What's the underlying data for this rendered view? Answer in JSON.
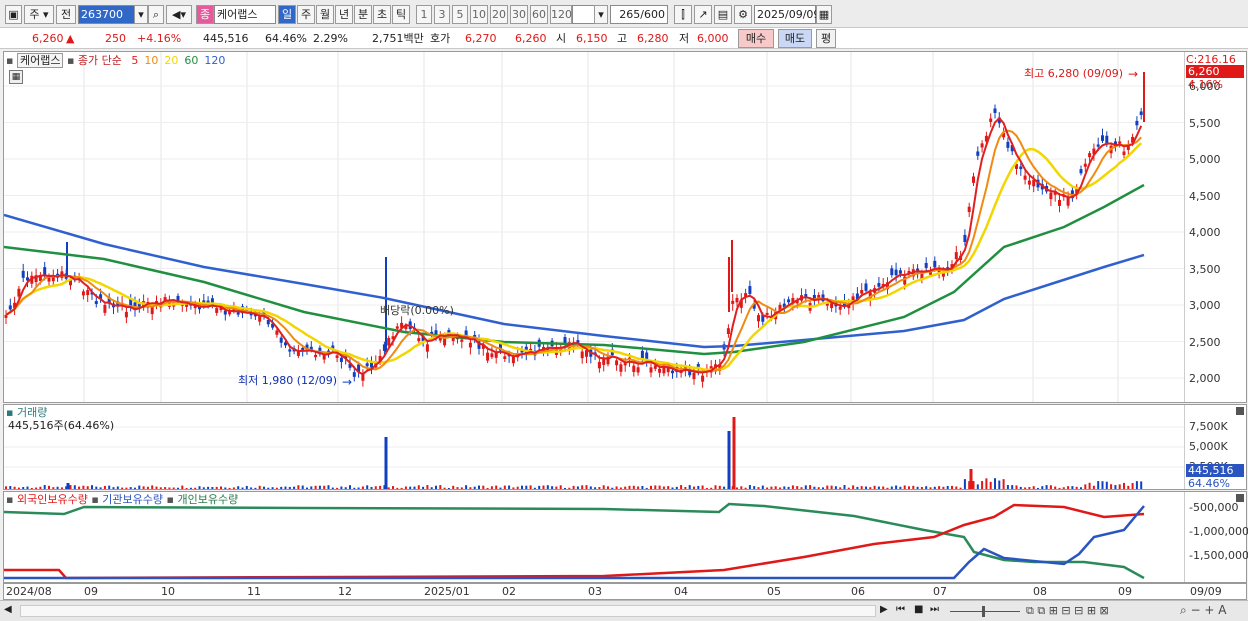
{
  "toolbar": {
    "period_week": "주",
    "period_prev": "전",
    "stock_code": "263700",
    "stock_tag": "종",
    "stock_name": "케어랩스",
    "tabs": [
      "일",
      "주",
      "월",
      "년",
      "분",
      "초",
      "틱"
    ],
    "active_tab": "일",
    "intervals": [
      "1",
      "3",
      "5",
      "10",
      "20",
      "30",
      "60",
      "120"
    ],
    "count": "265",
    "count_total": "/600",
    "date": "2025/09/09"
  },
  "quote": {
    "price": "6,260",
    "change": "250",
    "change_pct": "+4.16%",
    "volume": "445,516",
    "volume_pct": "64.46%",
    "turnover_pct": "2.29%",
    "amount": "2,751백만",
    "ask_label": "호가",
    "ask1": "6,270",
    "ask2": "6,260",
    "open_label": "시",
    "open": "6,150",
    "high_label": "고",
    "high": "6,280",
    "low_label": "저",
    "low": "6,000",
    "buy_label": "매수",
    "sell_label": "매도",
    "avg_label": "평"
  },
  "price_panel": {
    "stock_label": "케어랩스",
    "ma_label": "종가 단순",
    "ma_periods": [
      "5",
      "10",
      "20",
      "60",
      "120"
    ],
    "ma_colors": [
      "#e02020",
      "#f08a10",
      "#f2d600",
      "#209040",
      "#3060d0"
    ],
    "current_label": "C:216.16",
    "current_price": "6,260",
    "current_pct": "4.16%",
    "high_annot": "최고 6,280 (09/09)",
    "low_annot": "최저 1,980 (12/09)",
    "mid_annot": "배당락(0.00%)",
    "y_ticks": [
      "6,000",
      "5,500",
      "5,000",
      "4,500",
      "4,000",
      "3,500",
      "3,000",
      "2,500",
      "2,000"
    ]
  },
  "volume_panel": {
    "title": "거래량",
    "subtitle": "445,516주(64.46%)",
    "y_ticks": [
      "7,500K",
      "5,000K",
      "2,500K"
    ],
    "current": "445,516",
    "current_pct": "64.46%"
  },
  "holding_panel": {
    "series": [
      "외국인보유수량",
      "기관보유수량",
      "개인보유수량"
    ],
    "y_ticks": [
      "-500,000",
      "-1,000,000",
      "-1,500,000"
    ]
  },
  "x_axis": [
    "2024/08",
    "09",
    "10",
    "11",
    "12",
    "2025/01",
    "02",
    "03",
    "04",
    "05",
    "06",
    "07",
    "08",
    "09"
  ],
  "x_last": "09/09"
}
